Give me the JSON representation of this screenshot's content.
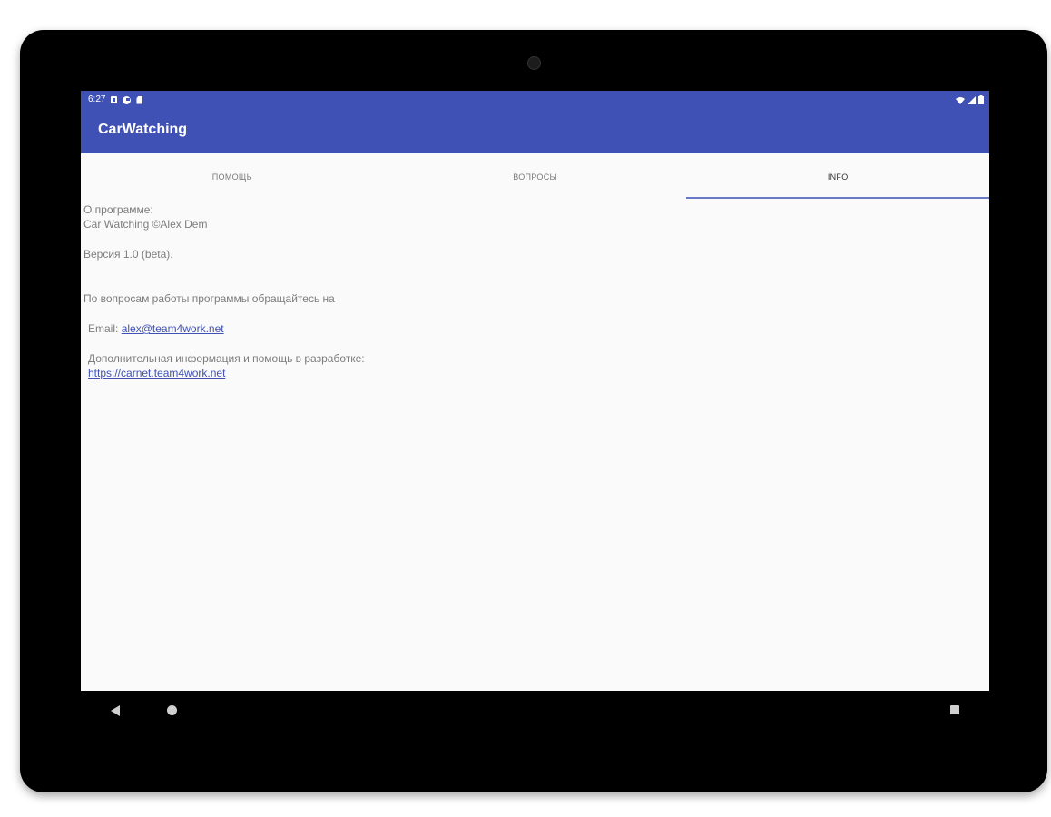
{
  "status_bar": {
    "time": "6:27",
    "left_icons": [
      "notification-square-icon",
      "sync-circle-icon",
      "sd-card-icon"
    ],
    "right_icons": [
      "wifi-icon",
      "cellular-signal-icon",
      "battery-icon"
    ]
  },
  "toolbar": {
    "title": "CarWatching"
  },
  "tabs": [
    {
      "label": "ПОМОЩЬ"
    },
    {
      "label": "ВОПРОСЫ"
    },
    {
      "label": "INFO",
      "selected": true
    }
  ],
  "info": {
    "about_label": "О программе:",
    "app_name": "Car Watching ©Alex Dem",
    "version": "Версия 1.0 (beta).",
    "contact_text": "По вопросам работы программы обращайтесь на",
    "email_label": "Email:",
    "email": "alex@team4work.net",
    "extra_text": "Дополнительная информация и помощь в разработке:",
    "url": "https://carnet.team4work.net"
  },
  "nav_bar": {
    "buttons": [
      "back-icon",
      "home-icon",
      "recents-icon"
    ]
  },
  "colors": {
    "primary": "#3f51b5",
    "device_bezel": "#000000",
    "background": "#fafafa",
    "link": "#3f51b5"
  }
}
